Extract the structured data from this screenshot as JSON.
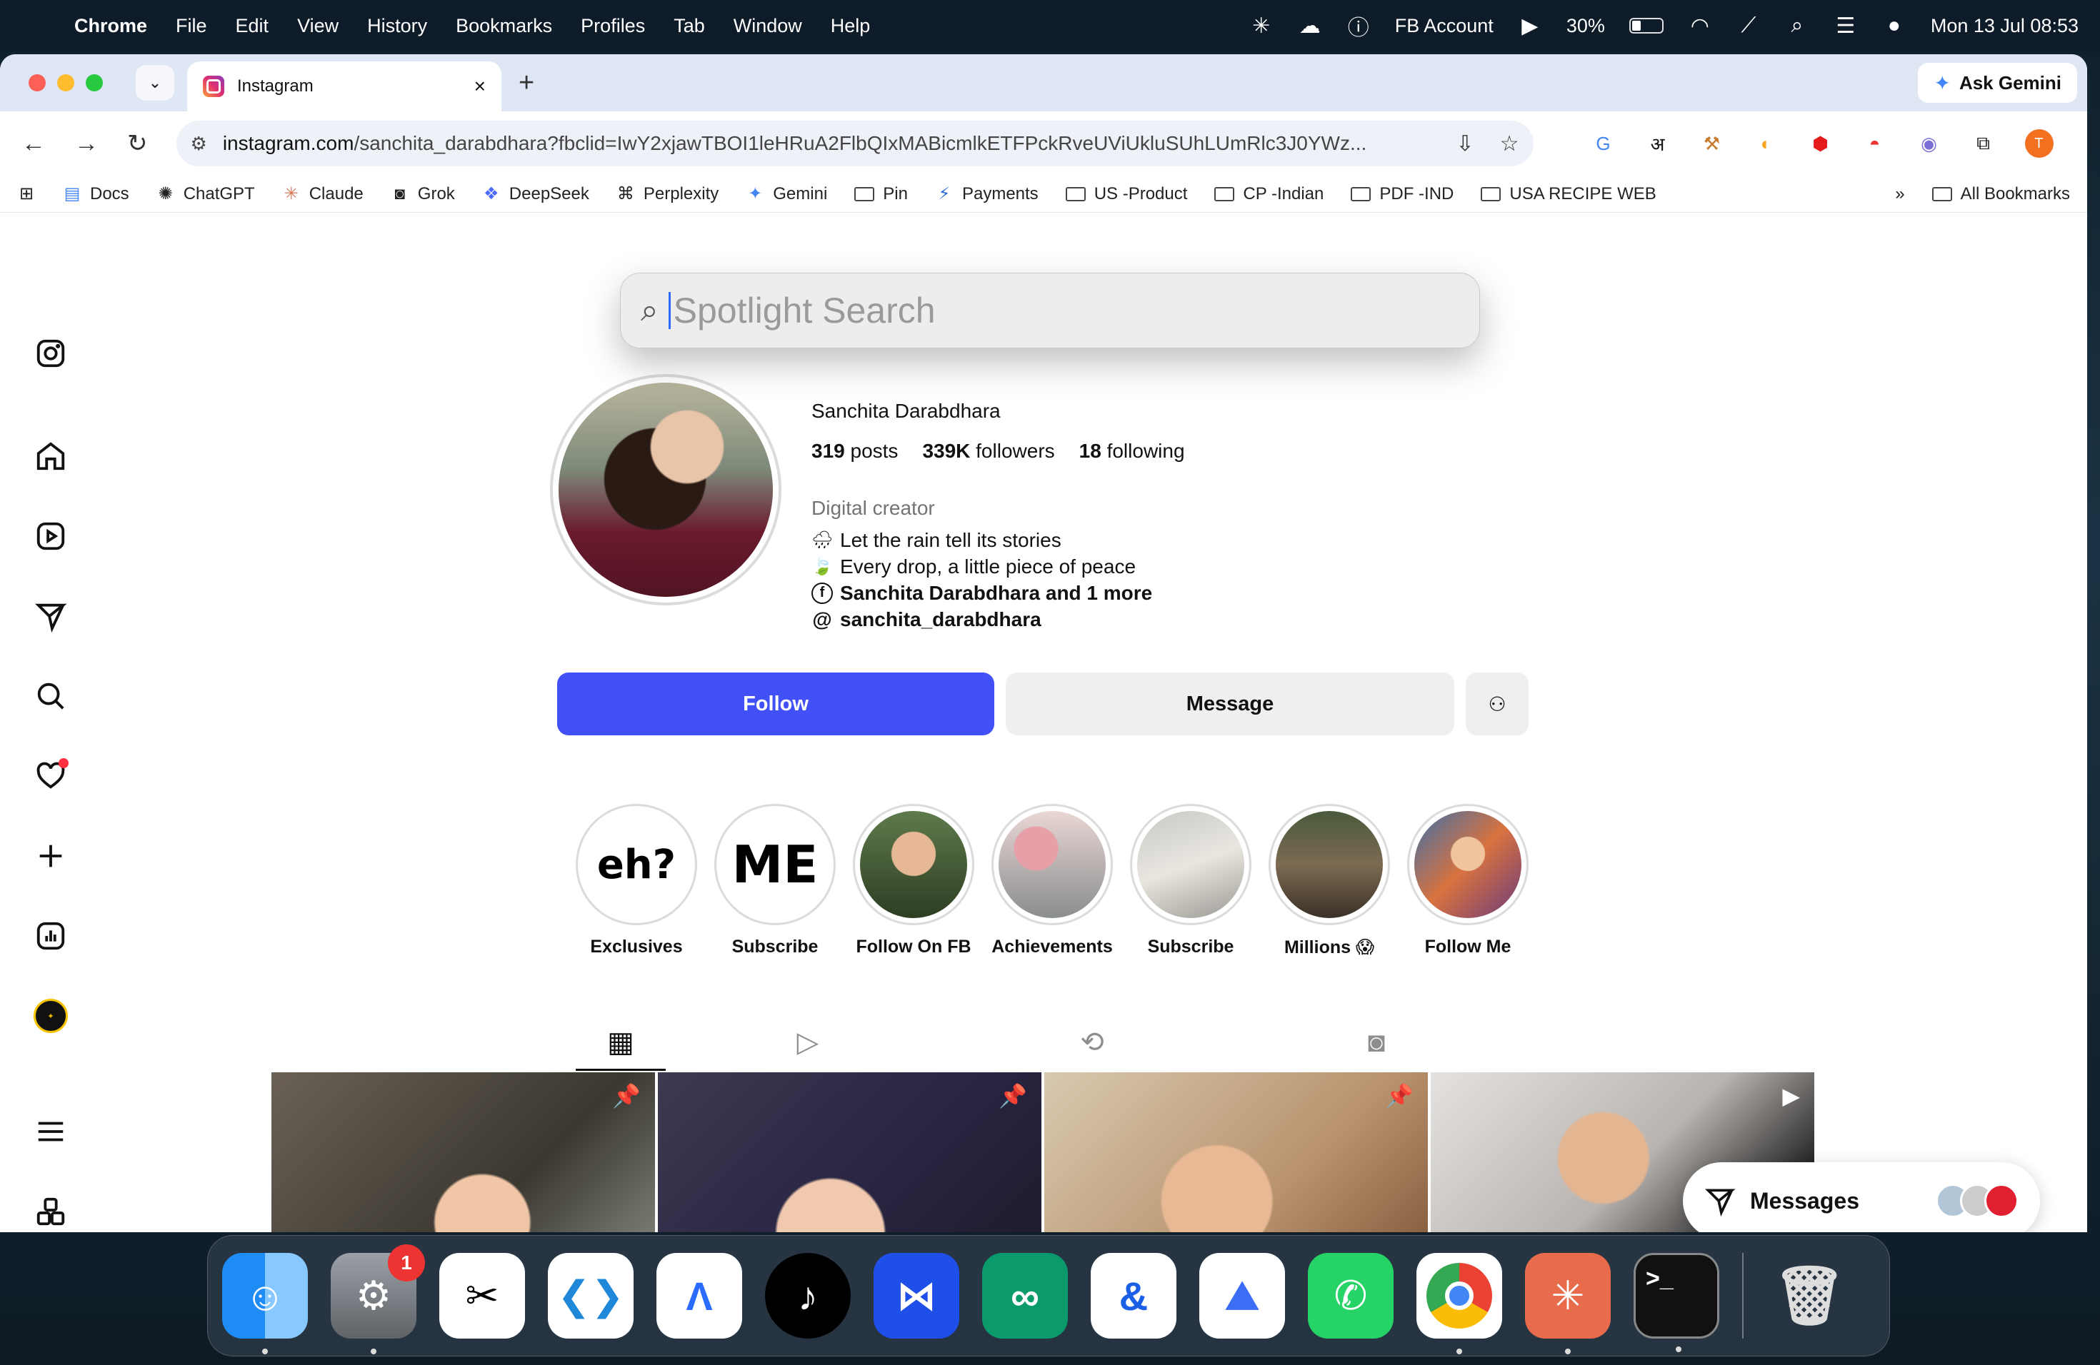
{
  "menubar": {
    "app_name": "Chrome",
    "items": [
      "File",
      "Edit",
      "View",
      "History",
      "Bookmarks",
      "Profiles",
      "Tab",
      "Window",
      "Help"
    ],
    "fb_account": "FB Account",
    "battery": "30%",
    "battery_level": 0.3,
    "datetime": "Mon 13 Jul  08:53"
  },
  "browser": {
    "tab_title": "Instagram",
    "ask_gemini": "Ask Gemini",
    "url_host": "instagram.com",
    "url_path": "/sanchita_darabdhara?fbclid=IwY2xjawTBOI1leHRuA2FlbQIxMABicmlkETFPckRveUViUkluSUhLUmRlc3J0YWz...",
    "profile_initial": "T",
    "bookmarks": [
      "Docs",
      "ChatGPT",
      "Claude",
      "Grok",
      "DeepSeek",
      "Perplexity",
      "Gemini",
      "Pin",
      "Payments",
      "US -Product",
      "CP -Indian",
      "PDF -IND",
      "USA RECIPE WEB"
    ],
    "all_bookmarks": "All Bookmarks",
    "more": "»"
  },
  "spotlight": {
    "placeholder": "Spotlight Search"
  },
  "profile": {
    "name": "Sanchita Darabdhara",
    "posts": "319",
    "posts_label": "posts",
    "followers": "339K",
    "followers_label": "followers",
    "following": "18",
    "following_label": "following",
    "category": "Digital creator",
    "bio_line1": "Let the rain tell its stories",
    "bio_line2": "Every drop, a little piece of peace",
    "fb_link": "Sanchita Darabdhara and 1 more",
    "threads_handle": "sanchita_darabdhara",
    "follow_label": "Follow",
    "message_label": "Message"
  },
  "highlights": [
    {
      "label": "Exclusives",
      "art": "eh?"
    },
    {
      "label": "Subscribe",
      "art": "ME"
    },
    {
      "label": "Follow On FB",
      "art": ""
    },
    {
      "label": "Achievements",
      "art": ""
    },
    {
      "label": "Subscribe",
      "art": ""
    },
    {
      "label": "Millions 😱",
      "art": ""
    },
    {
      "label": "Follow Me",
      "art": ""
    }
  ],
  "messages": {
    "label": "Messages"
  },
  "colors": {
    "follow_blue": "#4150f7",
    "notification_red": "#ff3040"
  },
  "dock": {
    "settings_badge": "1"
  }
}
